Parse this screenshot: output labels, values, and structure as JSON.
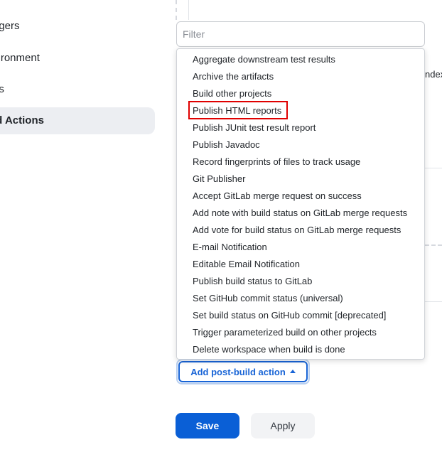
{
  "sidebar": {
    "items": [
      {
        "label": "ggers",
        "active": false
      },
      {
        "label": "vironment",
        "active": false
      },
      {
        "label": "ps",
        "active": false
      },
      {
        "label": "ld Actions",
        "active": true
      }
    ]
  },
  "main": {
    "behind_text": "ndex"
  },
  "filter": {
    "placeholder": "Filter",
    "value": ""
  },
  "menu": {
    "items": [
      "Aggregate downstream test results",
      "Archive the artifacts",
      "Build other projects",
      "Publish HTML reports",
      "Publish JUnit test result report",
      "Publish Javadoc",
      "Record fingerprints of files to track usage",
      "Git Publisher",
      "Accept GitLab merge request on success",
      "Add note with build status on GitLab merge requests",
      "Add vote for build status on GitLab merge requests",
      "E-mail Notification",
      "Editable Email Notification",
      "Publish build status to GitLab",
      "Set GitHub commit status (universal)",
      "Set build status on GitHub commit [deprecated]",
      "Trigger parameterized build on other projects",
      "Delete workspace when build is done"
    ],
    "highlighted": "Publish HTML reports",
    "highlight_color": "#e00000"
  },
  "post_build": {
    "label": "Add post-build action",
    "icon": "caret-up-icon"
  },
  "actions": {
    "save_label": "Save",
    "apply_label": "Apply"
  },
  "colors": {
    "primary": "#0a5fd6",
    "link": "#1864d6",
    "active_sidebar_bg": "#eceef2"
  }
}
